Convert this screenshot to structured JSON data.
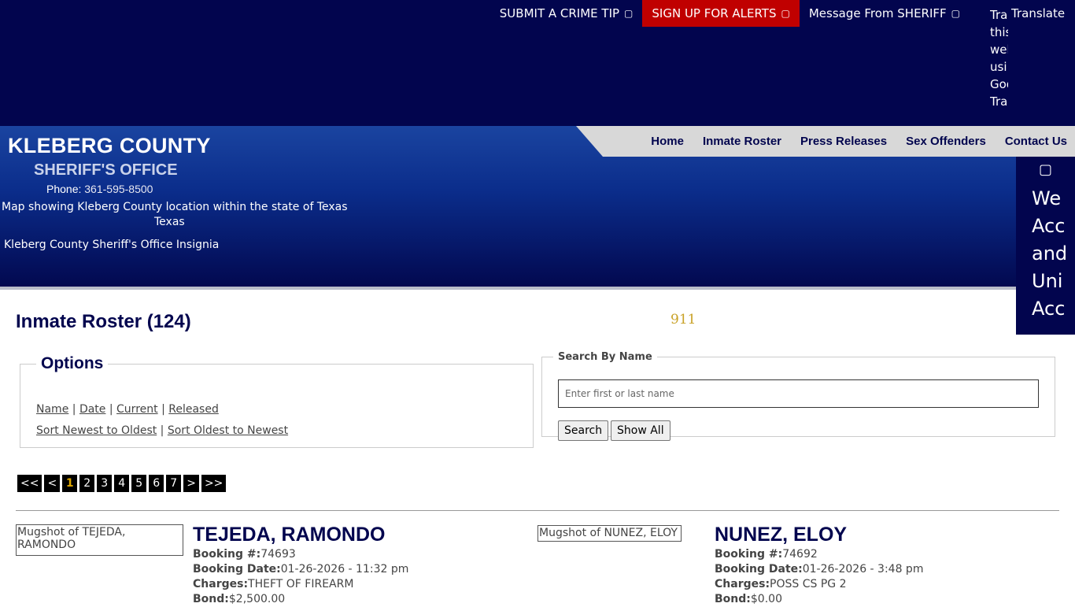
{
  "top_links": {
    "crime_tip": "SUBMIT A CRIME TIP",
    "alerts": "SIGN UP FOR ALERTS",
    "message": "Message From SHERIFF",
    "icon_crime_tip": "external-link-icon",
    "icon_alerts": "external-link-icon",
    "icon_message": "external-link-icon",
    "translate_label": "Translate",
    "translate_alt_lines": [
      "Tra",
      "this",
      "wel",
      "usi",
      "Goo",
      "Tra"
    ]
  },
  "nav": {
    "home": "Home",
    "roster": "Inmate Roster",
    "press": "Press Releases",
    "offenders": "Sex Offenders",
    "contact": "Contact Us"
  },
  "brand": {
    "county": "KLEBERG COUNTY",
    "office": "SHERIFF'S OFFICE",
    "phone_label": "Phone:",
    "phone": "361-595-8500",
    "map_alt": "Map showing Kleberg County location within the state of Texas",
    "map_label": "Texas",
    "insignia_alt": "Kleberg County Sheriff's Office Insignia"
  },
  "accessibility": {
    "icon": "accessibility-icon",
    "alt_lines": [
      "We",
      "Acc",
      "and",
      "Uni",
      "Acc"
    ]
  },
  "page": {
    "title": "Inmate Roster (124)",
    "emergency": "911"
  },
  "options": {
    "legend": "Options",
    "name": "Name",
    "date": "Date",
    "current": "Current",
    "released": "Released",
    "newest": "Sort Newest to Oldest",
    "oldest": "Sort Oldest to Newest"
  },
  "search": {
    "legend": "Search By Name",
    "placeholder": "Enter first or last name",
    "search_btn": "Search",
    "show_all_btn": "Show All"
  },
  "pager": [
    "<<",
    "<",
    "1",
    "2",
    "3",
    "4",
    "5",
    "6",
    "7",
    ">",
    ">>"
  ],
  "pager_active": "1",
  "inmates": [
    {
      "mug_alt": "Mugshot of TEJEDA, RAMONDO",
      "name": "TEJEDA, RAMONDO",
      "booking_label": "Booking #:",
      "booking": "74693",
      "date_label": "Booking Date:",
      "date": "01-26-2026 - 11:32 pm",
      "charges_label": "Charges:",
      "charges": "THEFT OF FIREARM",
      "bond_label": "Bond:",
      "bond": "$2,500.00"
    },
    {
      "mug_alt": "Mugshot of NUNEZ, ELOY",
      "name": "NUNEZ, ELOY",
      "booking_label": "Booking #:",
      "booking": "74692",
      "date_label": "Booking Date:",
      "date": "01-26-2026 - 3:48 pm",
      "charges_label": "Charges:",
      "charges": "POSS CS PG 2",
      "bond_label": "Bond:",
      "bond": "$0.00"
    }
  ],
  "colors": {
    "navy": "#02054e",
    "alert_red": "#c00000",
    "gold": "#c9a227"
  }
}
